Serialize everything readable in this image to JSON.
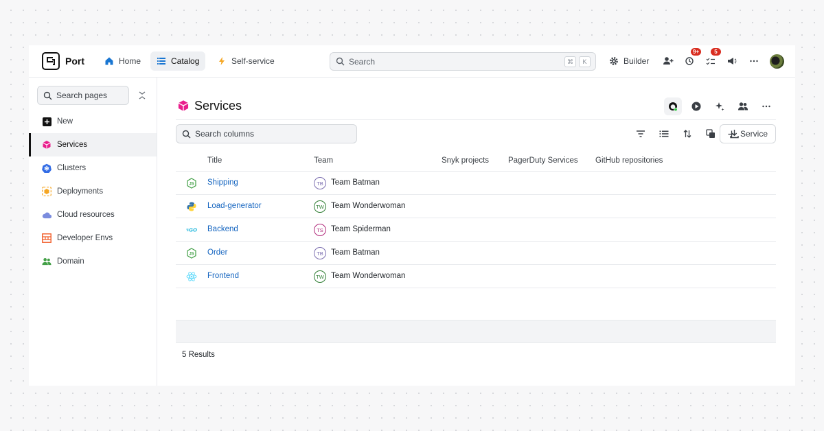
{
  "app": {
    "brand": "Port"
  },
  "nav": [
    {
      "label": "Home",
      "icon": "home-icon"
    },
    {
      "label": "Catalog",
      "icon": "list-icon",
      "active": true
    },
    {
      "label": "Self-service",
      "icon": "lightning-icon"
    }
  ],
  "search": {
    "placeholder": "Search",
    "kbd_cmd": "⌘",
    "kbd_key": "K"
  },
  "topbar_right": {
    "builder_label": "Builder",
    "history_badge": "9+",
    "tasks_badge": "5"
  },
  "sidebar": {
    "search_placeholder": "Search pages",
    "items": [
      {
        "label": "New",
        "icon": "plus-square-icon"
      },
      {
        "label": "Services",
        "icon": "cube-icon",
        "active": true
      },
      {
        "label": "Clusters",
        "icon": "kubernetes-icon"
      },
      {
        "label": "Deployments",
        "icon": "deployment-icon"
      },
      {
        "label": "Cloud resources",
        "icon": "cloud-icon"
      },
      {
        "label": "Developer Envs",
        "icon": "developer-env-icon"
      },
      {
        "label": "Domain",
        "icon": "users-icon"
      }
    ]
  },
  "page": {
    "title": "Services",
    "search_columns_placeholder": "Search columns",
    "add_button_label": "Service",
    "columns": [
      "Title",
      "Team",
      "Snyk projects",
      "PagerDuty Services",
      "GitHub repositories"
    ],
    "rows": [
      {
        "title": "Shipping",
        "lang_icon": "nodejs-icon",
        "team_initials": "TB",
        "team": "Team Batman",
        "team_color": "#7c6fb0"
      },
      {
        "title": "Load-generator",
        "lang_icon": "python-icon",
        "team_initials": "TW",
        "team": "Team Wonderwoman",
        "team_color": "#2e7d32"
      },
      {
        "title": "Backend",
        "lang_icon": "go-icon",
        "team_initials": "TS",
        "team": "Team Spiderman",
        "team_color": "#b0287a"
      },
      {
        "title": "Order",
        "lang_icon": "nodejs-icon",
        "team_initials": "TB",
        "team": "Team Batman",
        "team_color": "#7c6fb0"
      },
      {
        "title": "Frontend",
        "lang_icon": "react-icon",
        "team_initials": "TW",
        "team": "Team Wonderwoman",
        "team_color": "#2e7d32"
      }
    ],
    "results_label": "5 Results"
  },
  "colors": {
    "accent_link": "#1565c0",
    "services_icon": "#e91e8c",
    "badge": "#d92d20"
  }
}
